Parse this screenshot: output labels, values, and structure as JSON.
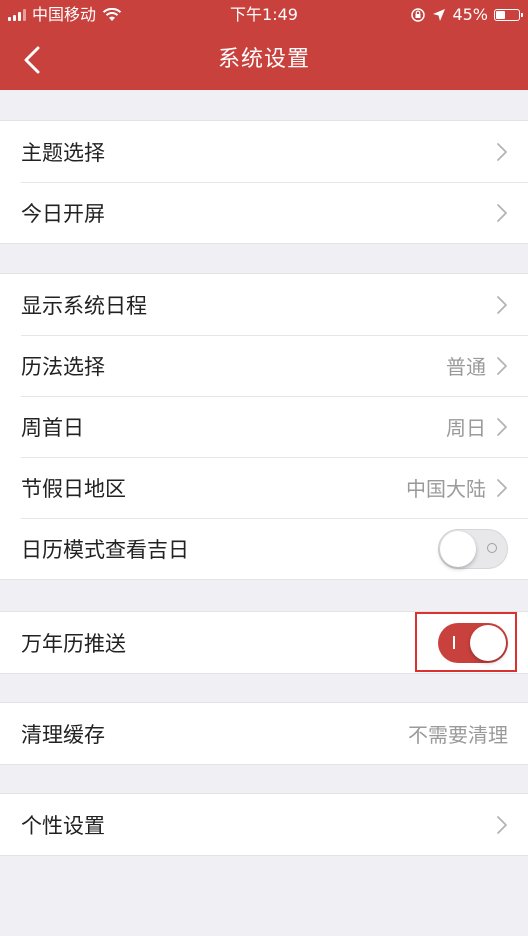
{
  "status_bar": {
    "carrier": "中国移动",
    "time": "下午1:49",
    "battery": "45%",
    "battery_level": 0.45
  },
  "nav": {
    "title": "系统设置"
  },
  "groups": [
    {
      "rows": [
        {
          "label": "主题选择",
          "value": "",
          "control": "chevron"
        },
        {
          "label": "今日开屏",
          "value": "",
          "control": "chevron"
        }
      ]
    },
    {
      "rows": [
        {
          "label": "显示系统日程",
          "value": "",
          "control": "chevron"
        },
        {
          "label": "历法选择",
          "value": "普通",
          "control": "chevron"
        },
        {
          "label": "周首日",
          "value": "周日",
          "control": "chevron"
        },
        {
          "label": "节假日地区",
          "value": "中国大陆",
          "control": "chevron"
        },
        {
          "label": "日历模式查看吉日",
          "value": "",
          "control": "switch",
          "switch_on": false
        }
      ]
    },
    {
      "rows": [
        {
          "label": "万年历推送",
          "value": "",
          "control": "switch",
          "switch_on": true
        }
      ]
    },
    {
      "rows": [
        {
          "label": "清理缓存",
          "value": "不需要清理",
          "control": "none"
        }
      ]
    },
    {
      "rows": [
        {
          "label": "个性设置",
          "value": "",
          "control": "chevron"
        }
      ]
    }
  ],
  "colors": {
    "accent": "#c9413d",
    "background": "#efeff4"
  }
}
